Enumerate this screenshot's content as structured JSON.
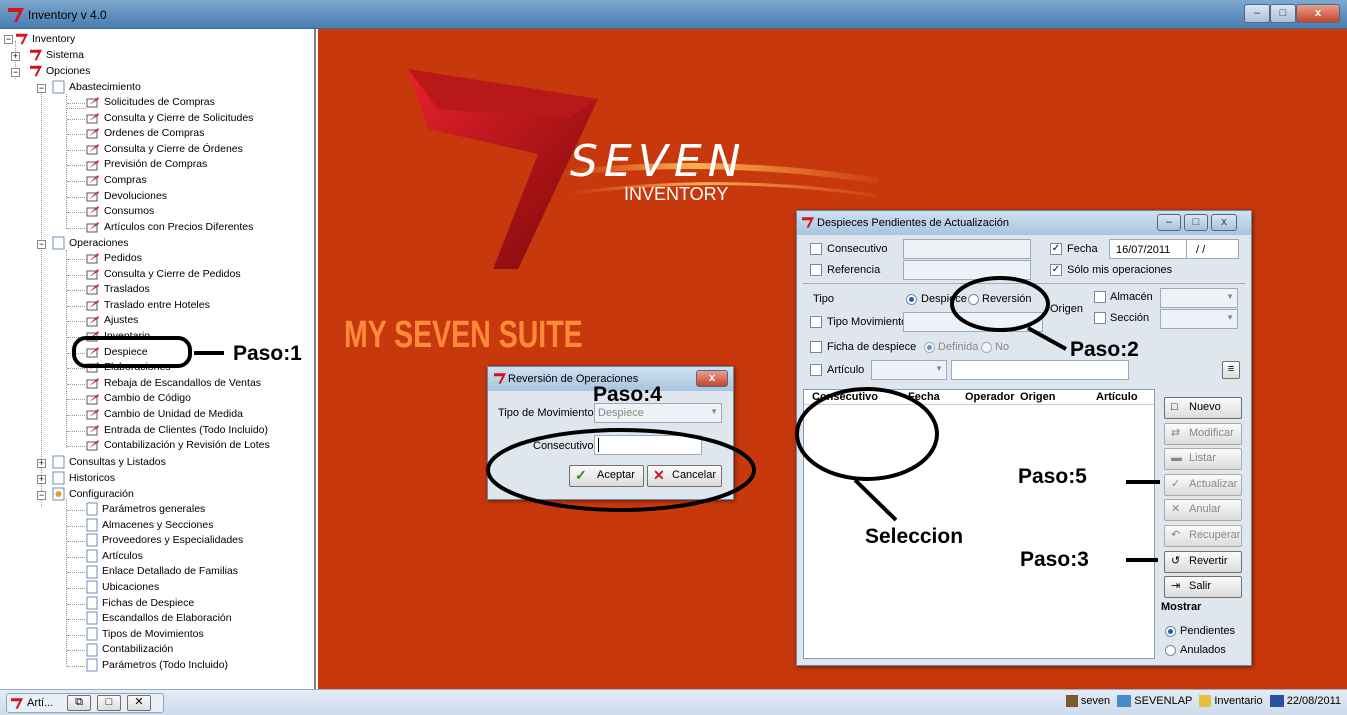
{
  "app": {
    "title": "Inventory v 4.0"
  },
  "window_controls": {
    "min": "–",
    "max": "□",
    "close": "x"
  },
  "tree": {
    "root": "Inventory",
    "nodes": {
      "sistema": "Sistema",
      "opciones": "Opciones",
      "abastecimiento": "Abastecimiento",
      "abast_items": [
        "Solicitudes de Compras",
        "Consulta y Cierre de Solicitudes",
        "Ordenes de Compras",
        "Consulta y Cierre de Órdenes",
        "Previsión de Compras",
        "Compras",
        "Devoluciones",
        "Consumos",
        "Artículos con Precios Diferentes"
      ],
      "operaciones": "Operaciones",
      "oper_items": [
        "Pedidos",
        "Consulta y Cierre de Pedidos",
        "Traslados",
        "Traslado entre Hoteles",
        "Ajustes",
        "Inventario",
        "Despiece",
        "Elaboraciones",
        "Rebaja de Escandallos de Ventas",
        "Cambio de Código",
        "Cambio de Unidad de Medida",
        "Entrada de Clientes (Todo Incluido)",
        "Contabilización y Revisión de Lotes"
      ],
      "consultas": "Consultas y Listados",
      "historicos": "Historicos",
      "configuracion": "Configuración",
      "config_items": [
        "Parámetros generales",
        "Almacenes y Secciones",
        "Proveedores y Especialidades",
        "Artículos",
        "Enlace Detallado de Familias",
        "Ubicaciones",
        "Fichas de Despiece",
        "Escandallos de Elaboración",
        "Tipos de Movimientos",
        "Contabilización",
        "Parámetros (Todo Incluido)"
      ]
    }
  },
  "brand": {
    "name": "SEVEN",
    "sub": "INVENTORY",
    "suite": "MY SEVEN SUITE"
  },
  "despieces": {
    "title": "Despieces Pendientes de Actualización",
    "consecutivo": "Consecutivo",
    "referencia": "Referencia",
    "fecha": "Fecha",
    "fecha_value": "16/07/2011",
    "fecha_value2": "/ /",
    "solo_mis": "Sólo mis operaciones",
    "tipo": "Tipo",
    "despiece": "Despiece",
    "reversion": "Reversión",
    "origen": "Origen",
    "almacen": "Almacén",
    "seccion": "Sección",
    "tipo_mov": "Tipo Movimiento",
    "ficha": "Ficha de despiece",
    "definida": "Definida",
    "no": "No",
    "articulo": "Artículo",
    "columns": [
      "Consecutivo",
      "Fecha",
      "Operador",
      "Origen",
      "Artículo"
    ],
    "buttons": [
      "Nuevo",
      "Modificar",
      "Listar",
      "Actualizar",
      "Anular",
      "Recuperar",
      "Revertir",
      "Salir"
    ],
    "mostrar": "Mostrar",
    "pendientes": "Pendientes",
    "anulados": "Anulados"
  },
  "reversion": {
    "title": "Reversión de Operaciones",
    "tipo_mov": "Tipo de Movimiento",
    "tipo_value": "Despiece",
    "consecutivo": "Consecutivo",
    "aceptar": "Aceptar",
    "cancelar": "Cancelar"
  },
  "annotations": {
    "p1": "Paso:1",
    "p2": "Paso:2",
    "p3": "Paso:3",
    "p4": "Paso:4",
    "p5": "Paso:5",
    "sel": "Seleccion"
  },
  "taskbar": {
    "task": "Artí...",
    "user": "seven",
    "host": "SEVENLAP",
    "db": "Inventario",
    "date": "22/08/2011"
  }
}
